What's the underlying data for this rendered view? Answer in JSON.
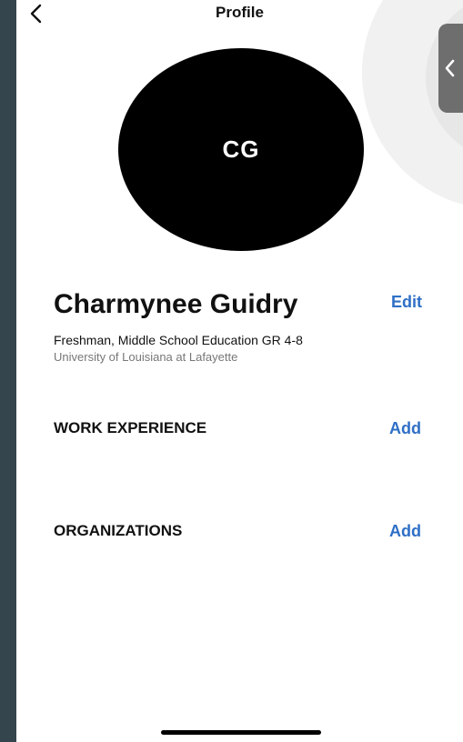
{
  "header": {
    "title": "Profile",
    "back_icon": "chevron-left-icon",
    "side_handle_icon": "chevron-left-icon"
  },
  "profile": {
    "initials": "CG",
    "name": "Charmynee Guidry",
    "edit_label": "Edit",
    "program": "Freshman, Middle School Education GR 4-8",
    "school": "University of Louisiana at Lafayette"
  },
  "sections": [
    {
      "title": "WORK EXPERIENCE",
      "action_label": "Add"
    },
    {
      "title": "ORGANIZATIONS",
      "action_label": "Add"
    }
  ],
  "colors": {
    "accent": "#2f6fc6",
    "background": "#ffffff",
    "outer_background": "#34454d",
    "avatar": "#000000"
  }
}
